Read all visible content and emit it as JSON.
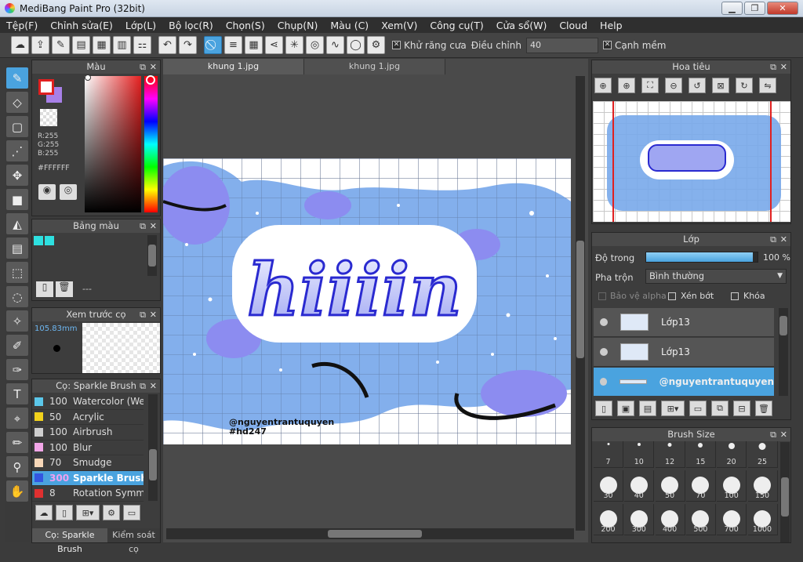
{
  "window": {
    "title": "MediBang Paint Pro (32bit)",
    "min": "▁",
    "max": "❐",
    "close": "✕"
  },
  "menu": [
    "Tệp(F)",
    "Chỉnh sửa(E)",
    "Lớp(L)",
    "Bộ lọc(R)",
    "Chọn(S)",
    "Chụp(N)",
    "Màu (C)",
    "Xem(V)",
    "Công cụ(T)",
    "Cửa sổ(W)",
    "Cloud",
    "Help"
  ],
  "toolbar": {
    "antialias_check": "✕",
    "antialias_label": "Khử răng cưa",
    "adjust_label": "Điều chỉnh",
    "adjust_value": "40",
    "softedge_check": "✕",
    "softedge_label": "Cạnh mềm"
  },
  "color_panel": {
    "title": "Màu",
    "r": "R:255",
    "g": "G:255",
    "b": "B:255",
    "hex": "#FFFFFF"
  },
  "palette_panel": {
    "title": "Bảng màu",
    "bottom_text": "---"
  },
  "brush_preview": {
    "title": "Xem trước cọ",
    "size": "105.83mm"
  },
  "brush_panel": {
    "title": "Cọ: Sparkle Brush",
    "items": [
      {
        "size": "100",
        "name": "Watercolor (Wet)",
        "color": "#5bc7ea"
      },
      {
        "size": "50",
        "name": "Acrylic",
        "color": "#f2d21c"
      },
      {
        "size": "100",
        "name": "Airbrush",
        "color": "#cfcfcf"
      },
      {
        "size": "100",
        "name": "Blur",
        "color": "#f2a6e8"
      },
      {
        "size": "70",
        "name": "Smudge",
        "color": "#f7d7b8"
      },
      {
        "size": "300",
        "name": "Sparkle Brush",
        "color": "#3356e0"
      },
      {
        "size": "8",
        "name": "Rotation Symmetry",
        "color": "#e03030"
      }
    ],
    "tab_brush": "Cọ: Sparkle Brush",
    "tab_control": "Kiểm soát cọ"
  },
  "tabs": [
    "khung 1.jpg",
    "khung 1.jpg"
  ],
  "canvas": {
    "artwork_text": "hiiiin",
    "watermark_line1": "@nguyentrantuquyen",
    "watermark_line2": "#hd247"
  },
  "navigator": {
    "title": "Hoa tiêu"
  },
  "layer_panel": {
    "title": "Lớp",
    "opacity_label": "Độ trong",
    "opacity_value": "100 %",
    "opacity_level": 0.96,
    "blend_label": "Pha trộn",
    "blend_value": "Bình thường",
    "protect_alpha": "Bảo vệ alpha",
    "clipping": "Xén bớt",
    "lock": "Khóa",
    "layers": [
      {
        "name": "Lớp13"
      },
      {
        "name": "Lớp13"
      },
      {
        "name": "@nguyentrantuquyen"
      }
    ]
  },
  "brush_size_panel": {
    "title": "Brush Size",
    "sizes": [
      "7",
      "10",
      "12",
      "15",
      "20",
      "25",
      "30",
      "40",
      "50",
      "70",
      "100",
      "150",
      "200",
      "300",
      "400",
      "500",
      "700",
      "1000"
    ]
  },
  "colors": {
    "accent": "#4aa3df",
    "canvas_blue": "#78a8ea",
    "lavender": "#8c8cf0"
  }
}
